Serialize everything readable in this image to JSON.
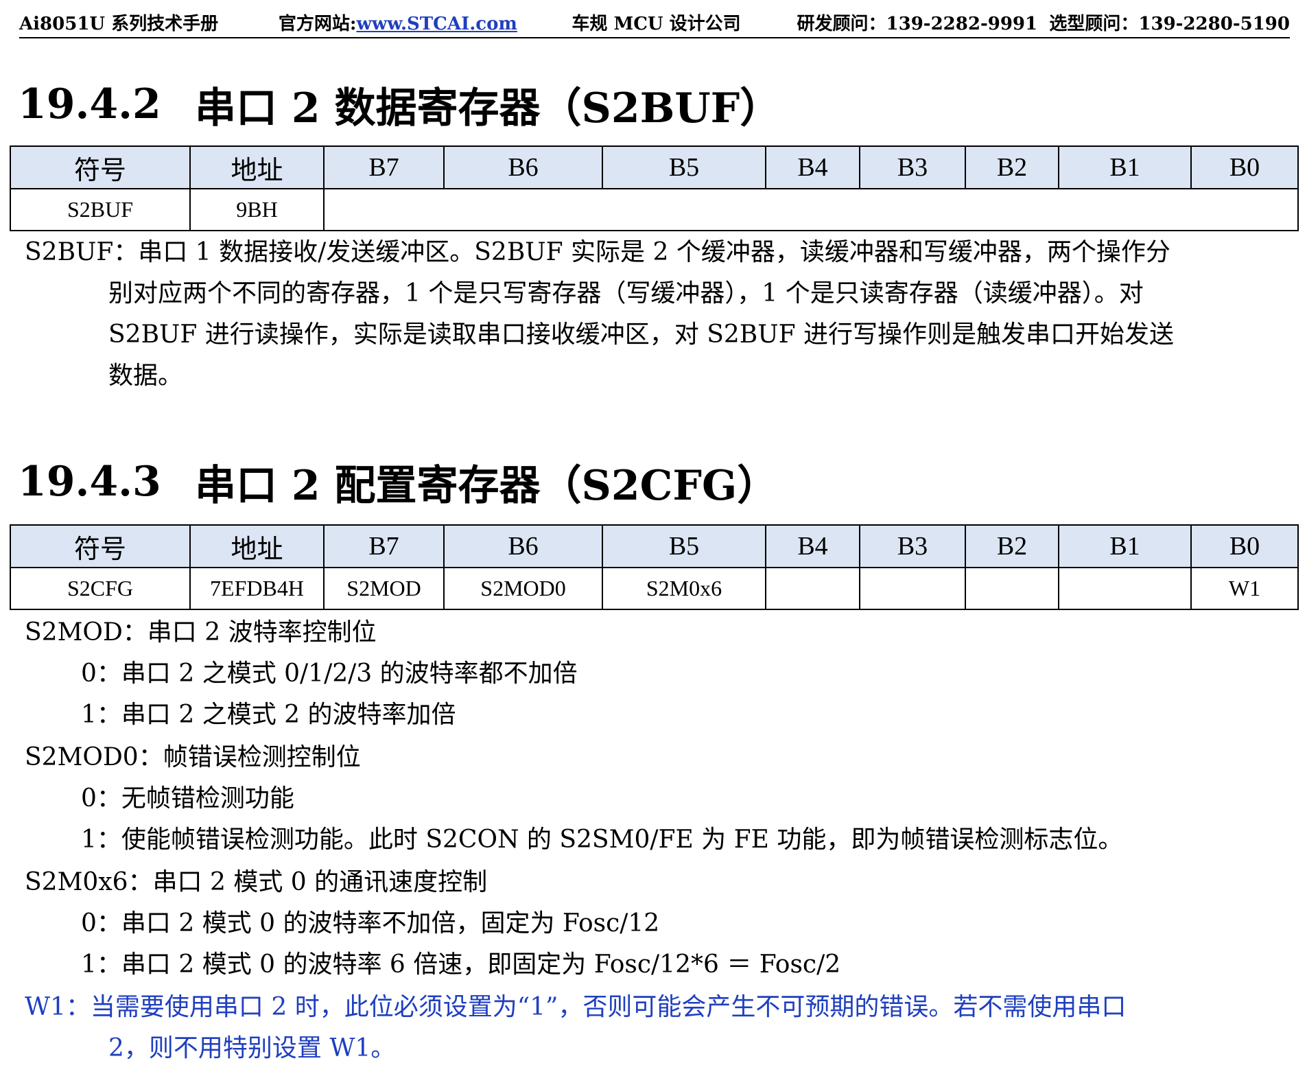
{
  "header": {
    "manual_title": "Ai8051U 系列技术手册",
    "site_label": "官方网站: ",
    "site_link": "www.STCAI.com",
    "company": "车规 MCU 设计公司",
    "rd_contact": "研发顾问：139-2282-9991",
    "sales_contact": "选型顾问：139-2280-5190"
  },
  "sections": [
    {
      "number": "19.4.2",
      "title": "串口 2 数据寄存器（S2BUF）",
      "table": {
        "headers": [
          "符号",
          "地址",
          "B7",
          "B6",
          "B5",
          "B4",
          "B3",
          "B2",
          "B1",
          "B0"
        ],
        "row": {
          "symbol": "S2BUF",
          "address": "9BH"
        }
      },
      "description": {
        "first_line": "S2BUF：串口 1 数据接收/发送缓冲区。S2BUF 实际是 2 个缓冲器，读缓冲器和写缓冲器，两个操作分",
        "line2": "别对应两个不同的寄存器，1 个是只写寄存器（写缓冲器），1 个是只读寄存器（读缓冲器）。对",
        "line3": "S2BUF 进行读操作，实际是读取串口接收缓冲区，对 S2BUF 进行写操作则是触发串口开始发送",
        "line4": "数据。"
      }
    },
    {
      "number": "19.4.3",
      "title": "串口 2 配置寄存器（S2CFG）",
      "table": {
        "headers": [
          "符号",
          "地址",
          "B7",
          "B6",
          "B5",
          "B4",
          "B3",
          "B2",
          "B1",
          "B0"
        ],
        "row": {
          "symbol": "S2CFG",
          "address": "7EFDB4H",
          "b7": "S2MOD",
          "b6": "S2MOD0",
          "b5": "S2M0x6",
          "b4": "",
          "b3": "",
          "b2": "",
          "b1": "",
          "b0": "W1"
        }
      },
      "bits": [
        {
          "label": "S2MOD：串口 2 波特率控制位",
          "items": [
            "0：串口 2 之模式 0/1/2/3 的波特率都不加倍",
            "1：串口 2 之模式 2 的波特率加倍"
          ]
        },
        {
          "label": "S2MOD0：帧错误检测控制位",
          "items": [
            "0：无帧错检测功能",
            "1：使能帧错误检测功能。此时 S2CON 的 S2SM0/FE 为 FE 功能，即为帧错误检测标志位。"
          ]
        },
        {
          "label": "S2M0x6：串口 2 模式 0 的通讯速度控制",
          "items": [
            "0：串口 2 模式 0 的波特率不加倍，固定为 Fosc/12",
            "1：串口 2 模式 0 的波特率 6 倍速，即固定为 Fosc/12*6 ＝ Fosc/2"
          ]
        }
      ],
      "note": {
        "line1": "W1：当需要使用串口 2 时，此位必须设置为“1”，否则可能会产生不可预期的错误。若不需使用串口",
        "line2": "2，则不用特别设置 W1。",
        "color": "#1f3fbf"
      }
    }
  ]
}
